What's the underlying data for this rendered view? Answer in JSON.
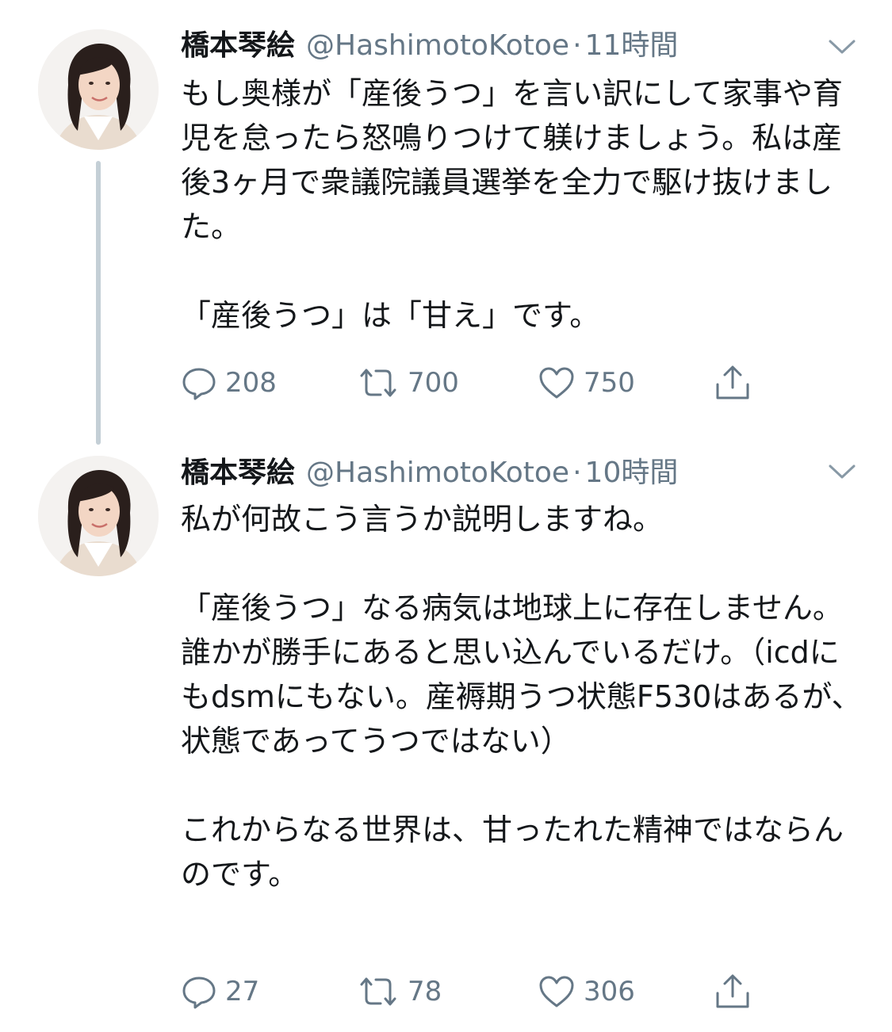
{
  "colors": {
    "text": "#14171a",
    "secondary": "#657786",
    "thread_line": "#c4cfd6",
    "background": "#ffffff"
  },
  "tweets": [
    {
      "display_name": "橋本琴絵",
      "handle": "@HashimotoKotoe",
      "separator": "·",
      "time": "11時間",
      "text": "もし奥様が「産後うつ」を言い訳にして家事や育児を怠ったら怒鳴りつけて躾けましょう。私は産後3ヶ月で衆議院議員選挙を全力で駆け抜けました。\n\n「産後うつ」は「甘え」です。",
      "replies": "208",
      "retweets": "700",
      "likes": "750",
      "icons": [
        "reply-icon",
        "retweet-icon",
        "like-icon",
        "share-icon",
        "chevron-down-icon"
      ]
    },
    {
      "display_name": "橋本琴絵",
      "handle": "@HashimotoKotoe",
      "separator": "·",
      "time": "10時間",
      "text": "私が何故こう言うか説明しますね。\n\n「産後うつ」なる病気は地球上に存在しません。誰かが勝手にあると思い込んでいるだけ。（icdにもdsmにもない。産褥期うつ状態F530はあるが、状態であってうつではない）\n\nこれからなる世界は、甘ったれた精神ではならんのです。",
      "replies": "27",
      "retweets": "78",
      "likes": "306",
      "icons": [
        "reply-icon",
        "retweet-icon",
        "like-icon",
        "share-icon",
        "chevron-down-icon"
      ]
    }
  ]
}
